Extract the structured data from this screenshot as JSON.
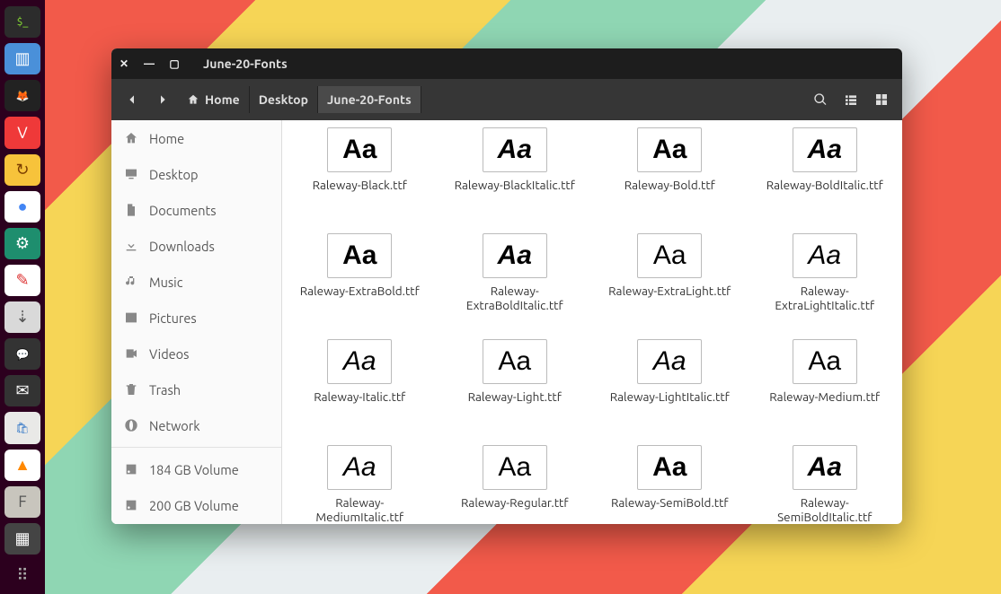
{
  "window": {
    "title": "June-20-Fonts",
    "breadcrumbs": [
      {
        "label": "Home",
        "has_icon": true
      },
      {
        "label": "Desktop"
      },
      {
        "label": "June-20-Fonts",
        "active": true
      }
    ]
  },
  "sidebar": {
    "top_items": [
      {
        "label": "Home",
        "icon": "home"
      },
      {
        "label": "Desktop",
        "icon": "desktop"
      },
      {
        "label": "Documents",
        "icon": "document"
      },
      {
        "label": "Downloads",
        "icon": "download"
      },
      {
        "label": "Music",
        "icon": "music"
      },
      {
        "label": "Pictures",
        "icon": "picture"
      },
      {
        "label": "Videos",
        "icon": "video"
      },
      {
        "label": "Trash",
        "icon": "trash"
      },
      {
        "label": "Network",
        "icon": "network"
      }
    ],
    "volumes": [
      {
        "label": "184 GB Volume"
      },
      {
        "label": "200 GB Volume"
      }
    ]
  },
  "files": [
    {
      "name": "Raleway-Black.ttf",
      "weight": "900",
      "italic": false
    },
    {
      "name": "Raleway-BlackItalic.ttf",
      "weight": "900",
      "italic": true
    },
    {
      "name": "Raleway-Bold.ttf",
      "weight": "700",
      "italic": false
    },
    {
      "name": "Raleway-BoldItalic.ttf",
      "weight": "700",
      "italic": true
    },
    {
      "name": "Raleway-ExtraBold.ttf",
      "weight": "800",
      "italic": false
    },
    {
      "name": "Raleway-ExtraBoldItalic.ttf",
      "weight": "800",
      "italic": true
    },
    {
      "name": "Raleway-ExtraLight.ttf",
      "weight": "200",
      "italic": false
    },
    {
      "name": "Raleway-ExtraLightItalic.ttf",
      "weight": "200",
      "italic": true
    },
    {
      "name": "Raleway-Italic.ttf",
      "weight": "400",
      "italic": true
    },
    {
      "name": "Raleway-Light.ttf",
      "weight": "300",
      "italic": false
    },
    {
      "name": "Raleway-LightItalic.ttf",
      "weight": "300",
      "italic": true
    },
    {
      "name": "Raleway-Medium.ttf",
      "weight": "500",
      "italic": false
    },
    {
      "name": "Raleway-MediumItalic.ttf",
      "weight": "500",
      "italic": true
    },
    {
      "name": "Raleway-Regular.ttf",
      "weight": "400",
      "italic": false
    },
    {
      "name": "Raleway-SemiBold.ttf",
      "weight": "600",
      "italic": false
    },
    {
      "name": "Raleway-SemiBoldItalic.ttf",
      "weight": "600",
      "italic": true
    }
  ],
  "launcher": [
    {
      "name": "terminal",
      "bg": "#2c2c2c",
      "fg": "#8ae234",
      "sym": "$_"
    },
    {
      "name": "files",
      "bg": "#4a90d9",
      "fg": "#fff",
      "sym": "▥"
    },
    {
      "name": "firefox",
      "bg": "#222",
      "fg": "#ff7139",
      "sym": "🦊"
    },
    {
      "name": "vivaldi",
      "bg": "#ef3939",
      "fg": "#fff",
      "sym": "V"
    },
    {
      "name": "sync",
      "bg": "#f7c33b",
      "fg": "#7a3d00",
      "sym": "↻"
    },
    {
      "name": "assistant",
      "bg": "#fff",
      "fg": "#4285f4",
      "sym": "●"
    },
    {
      "name": "dev",
      "bg": "#1e8e6e",
      "fg": "#fff",
      "sym": "⚙"
    },
    {
      "name": "notes",
      "bg": "#fff",
      "fg": "#d33",
      "sym": "✎"
    },
    {
      "name": "usb",
      "bg": "#d9d9d9",
      "fg": "#555",
      "sym": "⇣"
    },
    {
      "name": "chat",
      "bg": "#333",
      "fg": "#fff",
      "sym": "💬"
    },
    {
      "name": "mail",
      "bg": "#333",
      "fg": "#fff",
      "sym": "✉"
    },
    {
      "name": "software",
      "bg": "#e9e9e7",
      "fg": "#3478c7",
      "sym": "🛍"
    },
    {
      "name": "vlc",
      "bg": "#fff",
      "fg": "#ff8800",
      "sym": "▲"
    },
    {
      "name": "fonts",
      "bg": "#c8c5bd",
      "fg": "#555",
      "sym": "F"
    },
    {
      "name": "colors",
      "bg": "#444",
      "fg": "#fff",
      "sym": "▦"
    },
    {
      "name": "apps",
      "bg": "#2c001e",
      "fg": "#aaa",
      "sym": "⠿"
    }
  ]
}
